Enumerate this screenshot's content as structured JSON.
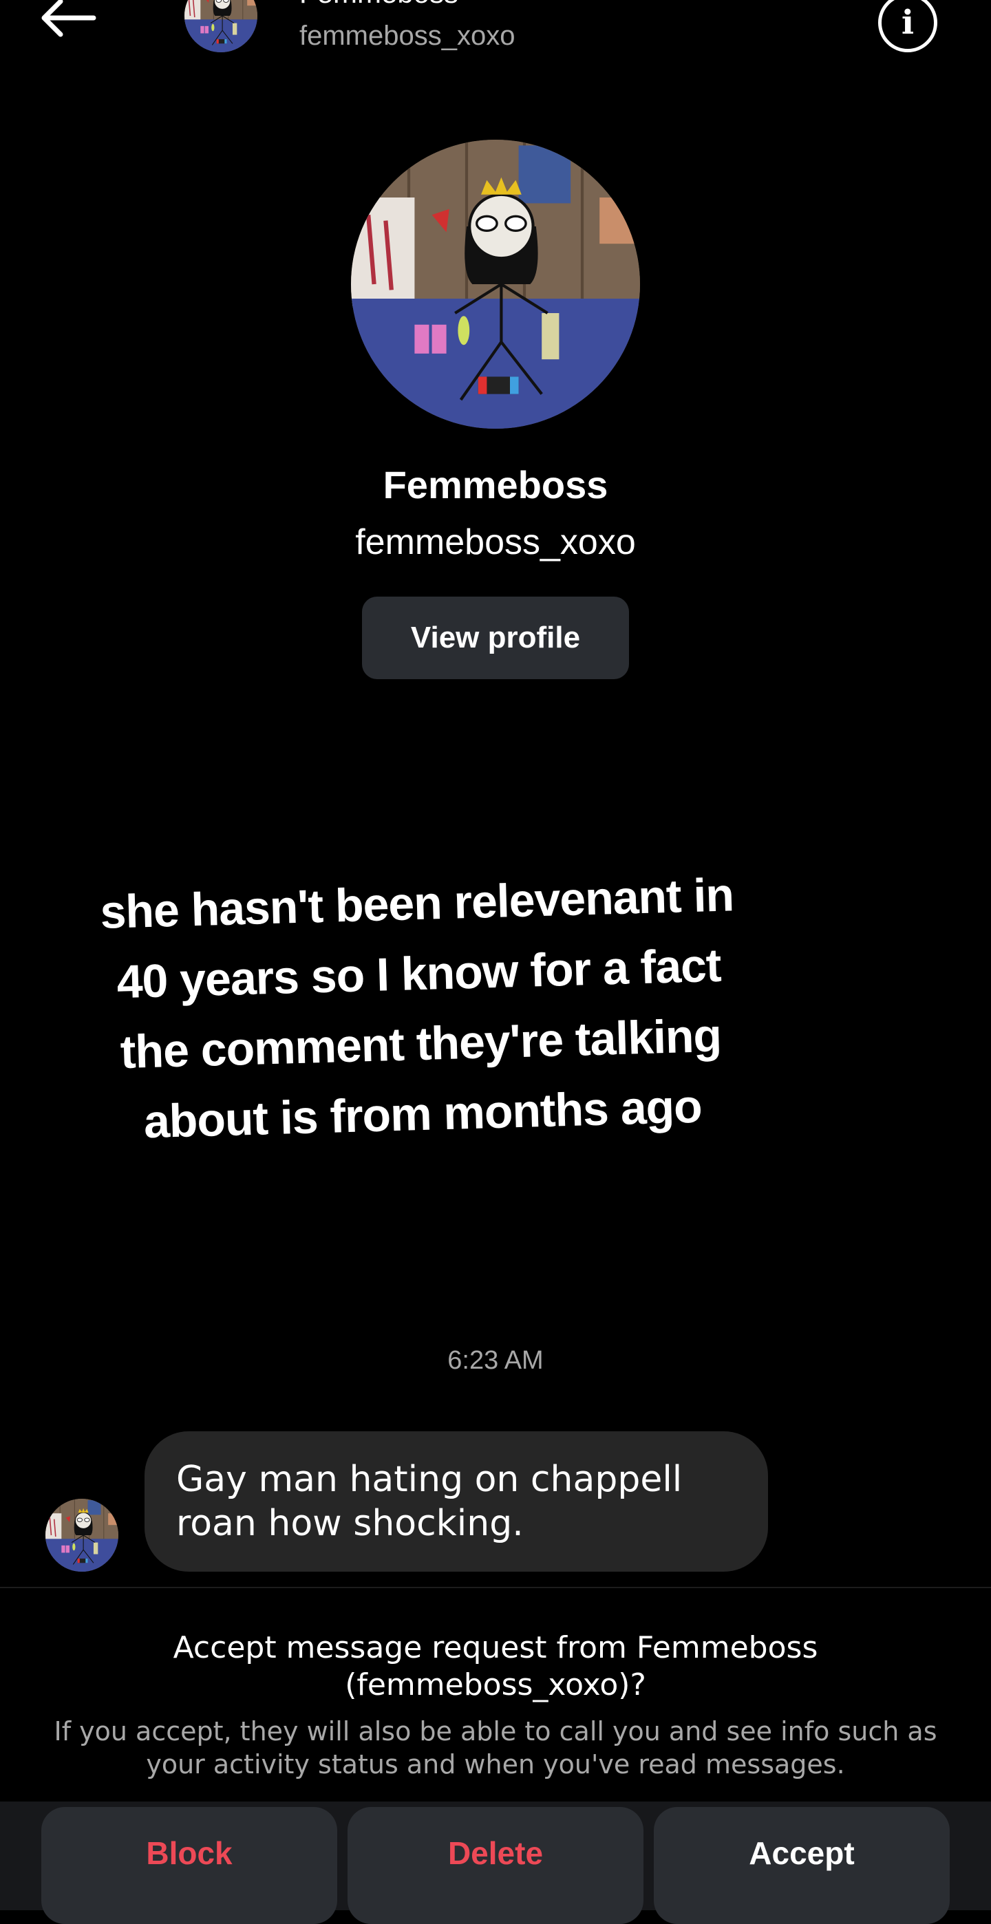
{
  "header": {
    "name": "Femmeboss",
    "username": "femmeboss_xoxo",
    "back_icon": "arrow-left-icon",
    "info_icon": "info-icon",
    "info_glyph": "i"
  },
  "profile": {
    "name": "Femmeboss",
    "username": "femmeboss_xoxo",
    "view_profile_label": "View profile"
  },
  "shared_video": {
    "caption_lines": [
      "she hasn't been relevenant in",
      "40 years so I know for a fact",
      "the comment they're talking",
      "about is from months ago"
    ]
  },
  "timestamp": "6:23 AM",
  "message": {
    "text": "Gay man hating on chappell roan how shocking."
  },
  "request": {
    "title": "Accept message request from Femmeboss (femmeboss_xoxo)?",
    "description": "If you accept, they will also be able to call you and see info such as your activity status and when you've read messages."
  },
  "actions": {
    "block_label": "Block",
    "delete_label": "Delete",
    "accept_label": "Accept"
  },
  "colors": {
    "background": "#000000",
    "button_bg": "#2a2d32",
    "danger": "#ed4956",
    "secondary_text": "#a8a8a8",
    "bubble": "#262626"
  }
}
